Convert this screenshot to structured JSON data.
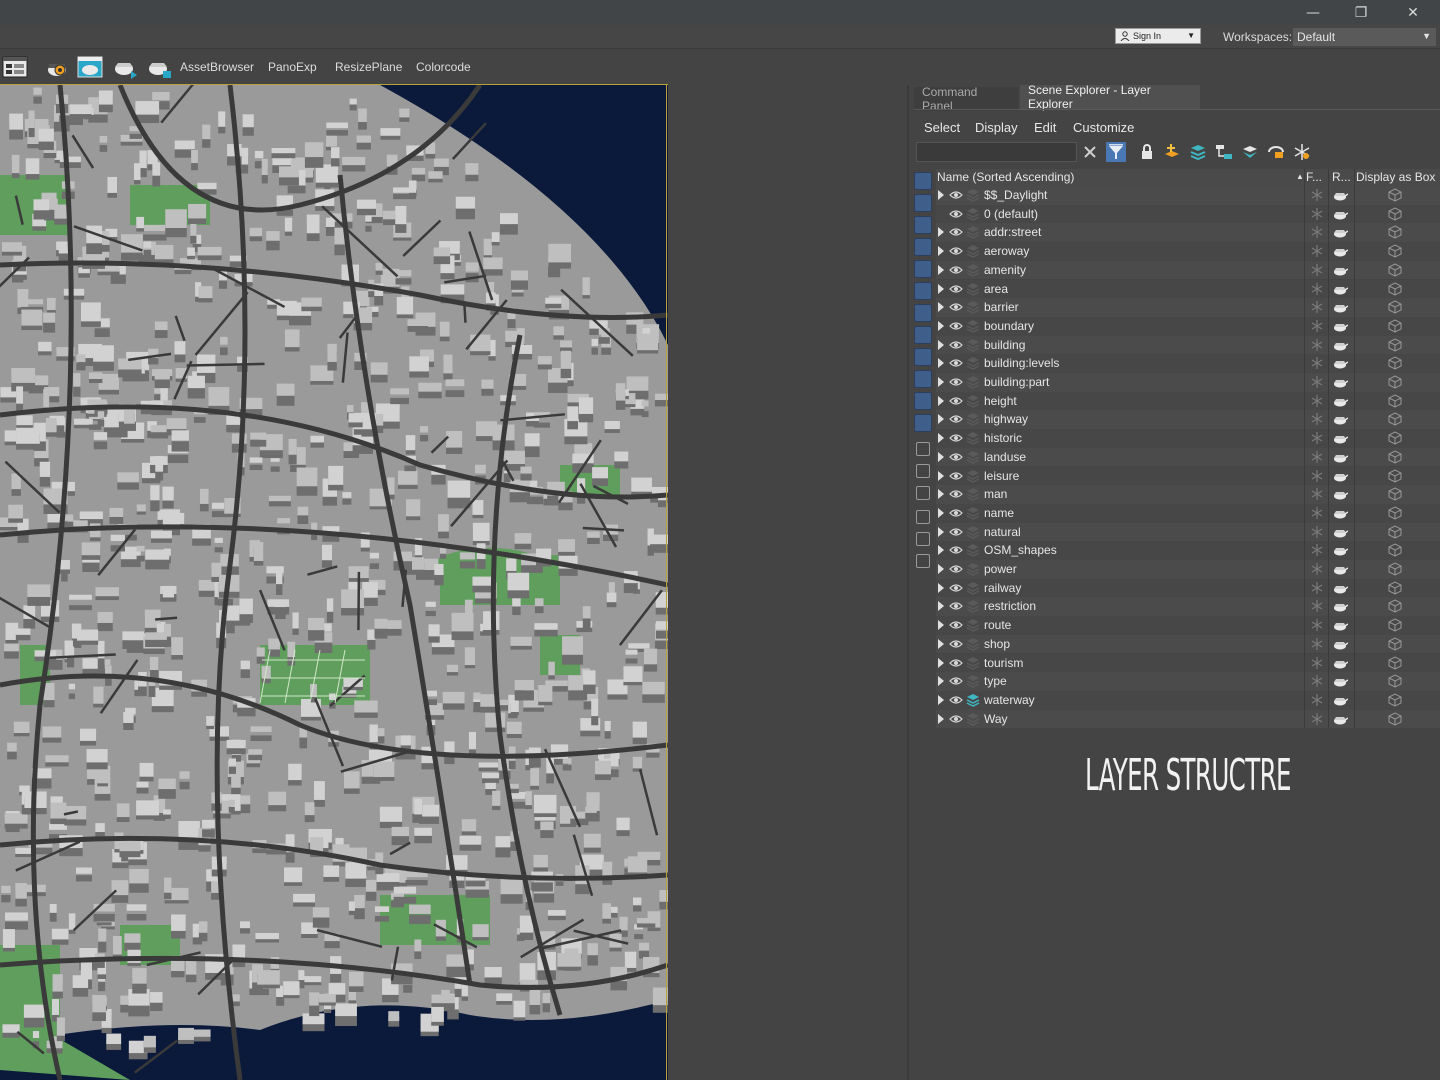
{
  "window": {
    "controls": [
      "—",
      "❐",
      "✕"
    ]
  },
  "workspace_row": {
    "sign_in": "Sign In",
    "workspaces_label": "Workspaces:",
    "workspace_value": "Default"
  },
  "toolbar": {
    "icons": [
      "layout-icon",
      "settings-teapot-icon",
      "render-frame-icon",
      "render-icon",
      "render-active-icon"
    ],
    "buttons": [
      "AssetBrowser",
      "PanoExp",
      "ResizePlane",
      "Colorcode"
    ]
  },
  "panel": {
    "tabs": [
      "Command Panel",
      "Scene Explorer - Layer Explorer"
    ],
    "active_tab": "Scene Explorer - Layer Explorer",
    "menu": [
      "Select",
      "Display",
      "Edit",
      "Customize"
    ],
    "search_value": "",
    "columns": {
      "name": "Name (Sorted Ascending)",
      "sort_indicator": "▲",
      "frozen": "F...",
      "renderable": "R...",
      "display_as_box": "Display as Box"
    },
    "layers": [
      {
        "name": "$$_Daylight",
        "expandable": true,
        "active": false
      },
      {
        "name": "0 (default)",
        "expandable": false,
        "active": false
      },
      {
        "name": "addr:street",
        "expandable": true,
        "active": false
      },
      {
        "name": "aeroway",
        "expandable": true,
        "active": false
      },
      {
        "name": "amenity",
        "expandable": true,
        "active": false
      },
      {
        "name": "area",
        "expandable": true,
        "active": false
      },
      {
        "name": "barrier",
        "expandable": true,
        "active": false
      },
      {
        "name": "boundary",
        "expandable": true,
        "active": false
      },
      {
        "name": "building",
        "expandable": true,
        "active": false
      },
      {
        "name": "building:levels",
        "expandable": true,
        "active": false
      },
      {
        "name": "building:part",
        "expandable": true,
        "active": false
      },
      {
        "name": "height",
        "expandable": true,
        "active": false
      },
      {
        "name": "highway",
        "expandable": true,
        "active": false
      },
      {
        "name": "historic",
        "expandable": true,
        "active": false
      },
      {
        "name": "landuse",
        "expandable": true,
        "active": false
      },
      {
        "name": "leisure",
        "expandable": true,
        "active": false
      },
      {
        "name": "man",
        "expandable": true,
        "active": false
      },
      {
        "name": "name",
        "expandable": true,
        "active": false
      },
      {
        "name": "natural",
        "expandable": true,
        "active": false
      },
      {
        "name": "OSM_shapes",
        "expandable": true,
        "active": false
      },
      {
        "name": "power",
        "expandable": true,
        "active": false
      },
      {
        "name": "railway",
        "expandable": true,
        "active": false
      },
      {
        "name": "restriction",
        "expandable": true,
        "active": false
      },
      {
        "name": "route",
        "expandable": true,
        "active": false
      },
      {
        "name": "shop",
        "expandable": true,
        "active": false
      },
      {
        "name": "tourism",
        "expandable": true,
        "active": false
      },
      {
        "name": "type",
        "expandable": true,
        "active": false
      },
      {
        "name": "waterway",
        "expandable": true,
        "active": true
      },
      {
        "name": "Way",
        "expandable": true,
        "active": false
      }
    ],
    "caption": "LAYER STRUCTRE"
  },
  "colors": {
    "viewport_border": "#b9a23a",
    "water": "#0b1a3a",
    "park": "#5f9e5c",
    "road": "#3a3a3a",
    "ground": "#9a9a9a",
    "building": "#d2d2d2",
    "active_layer": "#3fb7c2",
    "accent_blue": "#4a78b4"
  }
}
